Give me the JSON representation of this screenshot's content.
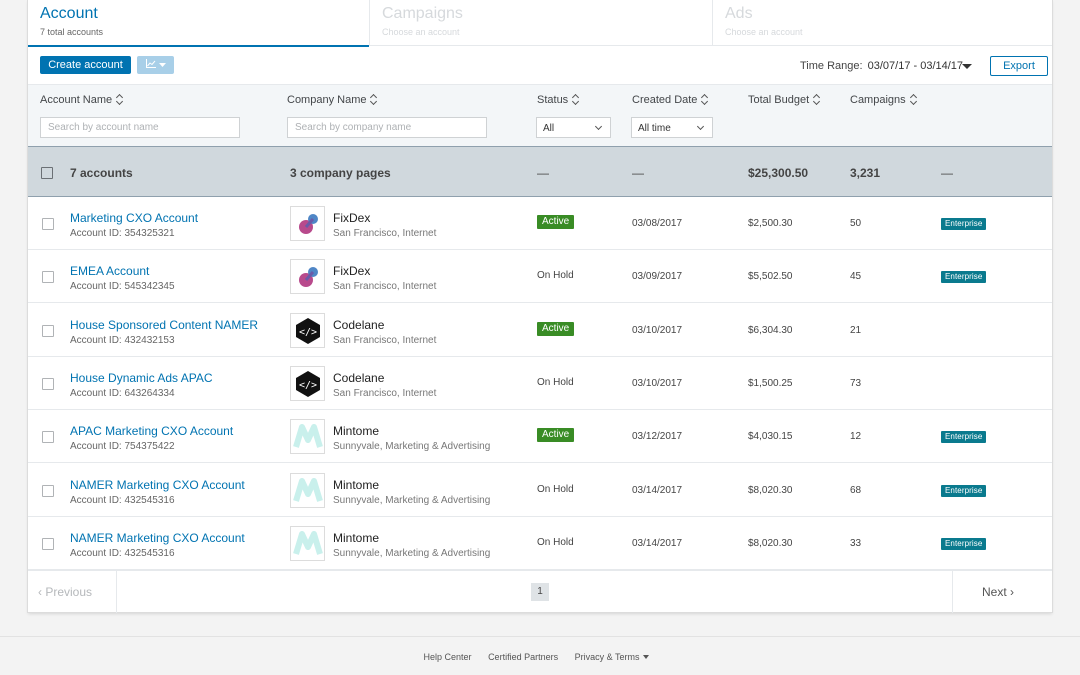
{
  "tabs": [
    {
      "title": "Account",
      "subtitle": "7 total accounts",
      "active": true
    },
    {
      "title": "Campaigns",
      "subtitle": "Choose an account",
      "active": false
    },
    {
      "title": "Ads",
      "subtitle": "Choose an account",
      "active": false
    }
  ],
  "toolbar": {
    "create_label": "Create account",
    "chart_icon": "line-chart-icon",
    "time_range_label": "Time Range:",
    "time_range_value": "03/07/17 - 03/14/17",
    "export_label": "Export"
  },
  "columns": {
    "account_name": "Account Name",
    "company_name": "Company Name",
    "status": "Status",
    "created_date": "Created Date",
    "total_budget": "Total Budget",
    "campaigns": "Campaigns"
  },
  "filters": {
    "account_placeholder": "Search by account name",
    "company_placeholder": "Search by company name",
    "status_value": "All",
    "date_value": "All time"
  },
  "summary": {
    "accounts": "7 accounts",
    "companies": "3 company pages",
    "status": "—",
    "date": "—",
    "budget": "$25,300.50",
    "campaigns": "3,231",
    "type": "—"
  },
  "rows": [
    {
      "name": "Marketing CXO Account",
      "id": "Account ID: 354325321",
      "company": "FixDex",
      "location": "San Francisco, Internet",
      "logo": "fixdex",
      "status": "Active",
      "date": "03/08/2017",
      "budget": "$2,500.30",
      "campaigns": "50",
      "badge": "Enterprise"
    },
    {
      "name": "EMEA Account",
      "id": "Account ID: 545342345",
      "company": "FixDex",
      "location": "San Francisco, Internet",
      "logo": "fixdex",
      "status": "On Hold",
      "date": "03/09/2017",
      "budget": "$5,502.50",
      "campaigns": "45",
      "badge": "Enterprise"
    },
    {
      "name": "House Sponsored Content NAMER",
      "id": "Account ID: 432432153",
      "company": "Codelane",
      "location": "San Francisco, Internet",
      "logo": "codelane",
      "status": "Active",
      "date": "03/10/2017",
      "budget": "$6,304.30",
      "campaigns": "21",
      "badge": ""
    },
    {
      "name": "House Dynamic Ads APAC",
      "id": "Account ID: 643264334",
      "company": "Codelane",
      "location": "San Francisco, Internet",
      "logo": "codelane",
      "status": "On Hold",
      "date": "03/10/2017",
      "budget": "$1,500.25",
      "campaigns": "73",
      "badge": ""
    },
    {
      "name": "APAC Marketing CXO Account",
      "id": "Account ID: 754375422",
      "company": "Mintome",
      "location": "Sunnyvale, Marketing & Advertising",
      "logo": "mintome",
      "status": "Active",
      "date": "03/12/2017",
      "budget": "$4,030.15",
      "campaigns": "12",
      "badge": "Enterprise"
    },
    {
      "name": "NAMER Marketing CXO Account",
      "id": "Account ID: 432545316",
      "company": "Mintome",
      "location": "Sunnyvale, Marketing & Advertising",
      "logo": "mintome",
      "status": "On Hold",
      "date": "03/14/2017",
      "budget": "$8,020.30",
      "campaigns": "68",
      "badge": "Enterprise"
    },
    {
      "name": "NAMER Marketing CXO Account",
      "id": "Account ID: 432545316",
      "company": "Mintome",
      "location": "Sunnyvale, Marketing & Advertising",
      "logo": "mintome",
      "status": "On Hold",
      "date": "03/14/2017",
      "budget": "$8,020.30",
      "campaigns": "33",
      "badge": "Enterprise"
    }
  ],
  "pager": {
    "previous": "Previous",
    "next": "Next",
    "page": "1"
  },
  "footer": {
    "help": "Help Center",
    "partners": "Certified Partners",
    "privacy": "Privacy & Terms"
  },
  "colors": {
    "accent": "#0073b1",
    "active": "#398c25",
    "enterprise": "#0a7a8e",
    "summary_bg": "#d0d8dd"
  }
}
